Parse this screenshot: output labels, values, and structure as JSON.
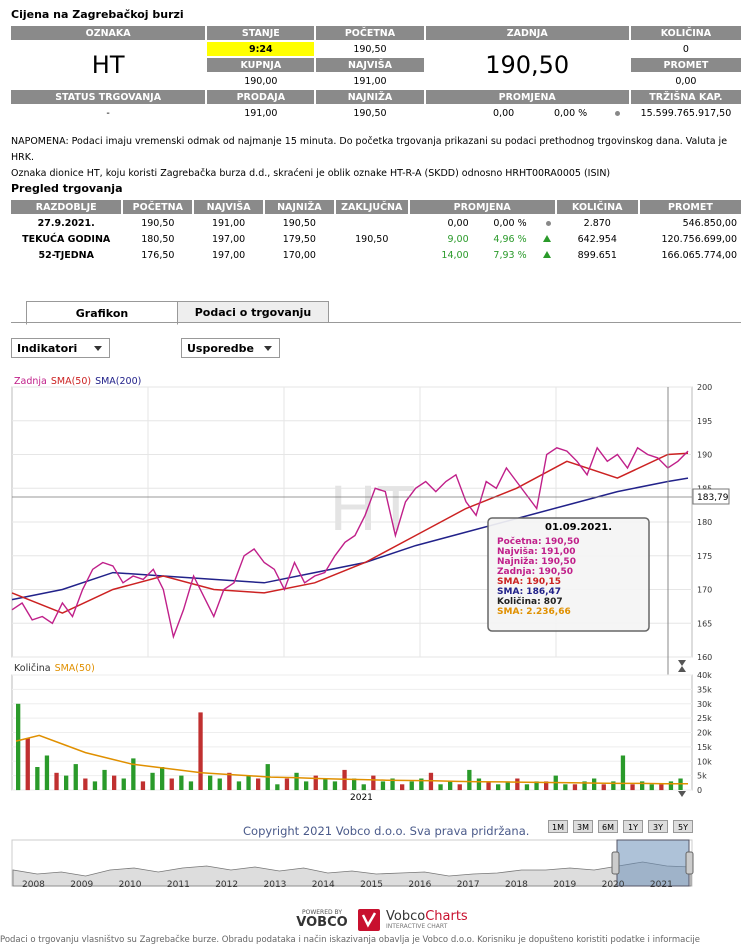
{
  "title": "Cijena na Zagrebačkoj burzi",
  "quote": {
    "oznaka_h": "OZNAKA",
    "oznaka": "HT",
    "stanje_h": "STANJE",
    "stanje": "9:24",
    "pocetna_h": "POČETNA",
    "pocetna": "190,50",
    "zadnja_h": "ZADNJA",
    "zadnja": "190,50",
    "kolicina_h": "KOLIČINA",
    "kolicina": "0",
    "kupnja_h": "KUPNJA",
    "kupnja": "190,00",
    "najvisa_h": "NAJVIŠA",
    "najvisa": "191,00",
    "promet_h": "PROMET",
    "promet": "0,00",
    "status_h": "STATUS TRGOVANJA",
    "status": "-",
    "prodaja_h": "PRODAJA",
    "prodaja": "191,00",
    "najniza_h": "NAJNIŽA",
    "najniza": "190,50",
    "promjena_h": "PROMJENA",
    "promjena": "0,00",
    "promjena_pct": "0,00 %",
    "trzisna_h": "TRŽIŠNA KAP.",
    "trzisna": "15.599.765.917,50"
  },
  "note": {
    "line1": "NAPOMENA: Podaci imaju vremenski odmak od najmanje 15 minuta. Do početka trgovanja prikazani su podaci prethodnog trgovinskog dana. Valuta je HRK.",
    "line2": "Oznaka dionice HT, koju koristi Zagrebačka burza d.d., skraćeni je oblik oznake HT-R-A (SKDD) odnosno HRHT00RA0005 (ISIN)"
  },
  "overview": {
    "title": "Pregled trgovanja",
    "headers": [
      "RAZDOBLJE",
      "POČETNA",
      "NAJVIŠA",
      "NAJNIŽA",
      "ZAKLJUČNA",
      "PROMJENA",
      "KOLIČINA",
      "PROMET"
    ],
    "zakljucna": "190,50",
    "rows": [
      {
        "period": "27.9.2021.",
        "open": "190,50",
        "high": "191,00",
        "low": "190,50",
        "chg": "0,00",
        "pct": "0,00 %",
        "qty": "2.870",
        "turnover": "546.850,00"
      },
      {
        "period": "TEKUĆA GODINA",
        "open": "180,50",
        "high": "197,00",
        "low": "179,50",
        "chg": "9,00",
        "pct": "4,96 %",
        "qty": "642.954",
        "turnover": "120.756.699,00"
      },
      {
        "period": "52-TJEDNA",
        "open": "176,50",
        "high": "197,00",
        "low": "170,00",
        "chg": "14,00",
        "pct": "7,93 %",
        "qty": "899.651",
        "turnover": "166.065.774,00"
      }
    ]
  },
  "tabs": [
    "Grafikon",
    "Podaci o trgovanju"
  ],
  "dropdowns": {
    "indikatori": "Indikatori",
    "usporedbe": "Usporedbe"
  },
  "price_legend": {
    "zadnja": "Zadnja",
    "sma50": "SMA(50)",
    "sma200": "SMA(200)"
  },
  "watermark": "HT",
  "price_axis": [
    "200",
    "195",
    "190",
    "185",
    "180",
    "175",
    "170",
    "165",
    "160"
  ],
  "crosshair_label": "183,79",
  "tooltip": {
    "date": "01.09.2021.",
    "lines": [
      {
        "text": "Početna: 190,50",
        "color": "#c0208a"
      },
      {
        "text": "Najviša: 191,00",
        "color": "#c0208a"
      },
      {
        "text": "Najniža: 190,50",
        "color": "#c0208a"
      },
      {
        "text": "Zadnja: 190,50",
        "color": "#c0208a"
      },
      {
        "text": "SMA: 190,15",
        "color": "#cc2222"
      },
      {
        "text": "SMA: 186,47",
        "color": "#22228a"
      },
      {
        "text": "Količina: 807",
        "color": "#222222"
      },
      {
        "text": "SMA: 2.236,66",
        "color": "#e09000"
      }
    ]
  },
  "volume_legend": {
    "kolicina": "Količina",
    "sma50": "SMA(50)"
  },
  "volume_axis": [
    "40k",
    "35k",
    "30k",
    "25k",
    "20k",
    "15k",
    "10k",
    "5k",
    "0"
  ],
  "volume_xlabel": "2021",
  "copyright": "Copyright 2021 Vobco d.o.o. Sva prava pridržana.",
  "ranges": [
    "1M",
    "3M",
    "6M",
    "1Y",
    "3Y",
    "5Y"
  ],
  "navigator_years": [
    "2008",
    "2009",
    "2010",
    "2011",
    "2012",
    "2013",
    "2014",
    "2015",
    "2016",
    "2017",
    "2018",
    "2019",
    "2020",
    "2021"
  ],
  "brand": {
    "powered": "POWERED BY",
    "vobco": "VOBCO",
    "charts1": "Vobco",
    "charts2": "Charts",
    "interactive": "INTERACTIVE CHART"
  },
  "footer": "Podaci o trgovanju vlasništvo su Zagrebačke burze. Obradu podataka i način iskazivanja obavlja je Vobco d.o.o. Korisniku je dopušteno koristiti podatke i informacije",
  "colors": {
    "header_gray": "#8a8a8a",
    "highlight": "#ffff00",
    "price": "#c0208a",
    "sma50": "#cc2222",
    "sma200": "#22228a",
    "vol_sma": "#e09000",
    "up": "#2a9a2a"
  },
  "chart_data": [
    {
      "type": "line",
      "title": "",
      "series": [
        {
          "name": "Zadnja",
          "x": [
            0,
            10,
            20,
            30,
            40,
            50,
            60,
            70,
            80,
            90,
            100,
            110,
            120,
            130,
            140,
            150,
            160,
            170,
            180,
            190,
            200,
            210,
            220,
            230,
            240,
            250,
            260,
            270,
            280,
            290,
            300,
            310,
            320,
            330,
            340,
            350,
            360,
            370,
            380,
            390,
            400,
            410,
            420,
            430,
            440,
            450,
            460,
            470,
            480,
            490,
            500,
            510,
            520,
            530,
            540,
            550,
            560,
            570,
            580,
            590,
            600,
            610,
            620,
            630,
            640,
            650,
            660,
            670
          ],
          "values": [
            167,
            168,
            165.5,
            166,
            165,
            168,
            166,
            170,
            173,
            174,
            173.5,
            171,
            172,
            171.5,
            173,
            170,
            163,
            167,
            172,
            169,
            166,
            170,
            171,
            175,
            176,
            174,
            173,
            170,
            174,
            171,
            172,
            172.5,
            175,
            177,
            178,
            181,
            185,
            184.5,
            178,
            183,
            185,
            186,
            184.5,
            186,
            187,
            183,
            181,
            186,
            185,
            188,
            186,
            184,
            182,
            190,
            191,
            190.5,
            189,
            187,
            191,
            189,
            190,
            188,
            191,
            190,
            189.5,
            188,
            189,
            190.5
          ]
        },
        {
          "name": "SMA(50)",
          "x": [
            0,
            50,
            100,
            150,
            200,
            250,
            300,
            350,
            400,
            450,
            500,
            550,
            600,
            650,
            670
          ],
          "values": [
            169.5,
            166.5,
            170,
            172,
            170,
            169.5,
            171,
            174,
            178,
            182,
            185,
            189,
            186.5,
            190,
            190.2
          ]
        },
        {
          "name": "SMA(200)",
          "x": [
            0,
            50,
            100,
            150,
            200,
            250,
            300,
            350,
            400,
            450,
            500,
            550,
            600,
            650,
            670
          ],
          "values": [
            168.5,
            170,
            172.5,
            172,
            171.5,
            171,
            172.5,
            174,
            176.5,
            178.5,
            180.5,
            182.5,
            184.5,
            186,
            186.5
          ]
        }
      ],
      "ylim": [
        160,
        200
      ]
    },
    {
      "type": "bar",
      "series": [
        {
          "name": "Količina",
          "values": [
            30,
            18,
            8,
            12,
            6,
            5,
            9,
            4,
            3,
            7,
            5,
            4,
            11,
            3,
            6,
            8,
            4,
            5,
            3,
            27,
            5,
            4,
            6,
            3,
            5,
            4,
            9,
            2,
            4,
            6,
            3,
            5,
            4,
            3,
            7,
            4,
            2,
            5,
            3,
            4,
            2,
            3,
            4,
            6,
            2,
            3,
            2,
            7,
            4,
            3,
            2,
            3,
            4,
            2,
            3,
            3,
            5,
            2,
            2,
            3,
            4,
            2,
            3,
            12,
            2,
            3,
            2,
            2,
            3,
            4
          ]
        },
        {
          "name": "SMA(50)",
          "values": [
            17,
            19,
            16,
            13,
            11,
            9,
            8,
            7,
            6,
            5.5,
            5,
            4.5,
            4.3,
            4,
            3.8,
            3.6,
            3.4,
            3.3,
            3.2,
            3,
            2.9,
            2.8,
            2.7,
            2.6,
            2.5,
            2.4,
            2.3,
            2.3,
            2.2,
            2.2
          ]
        }
      ],
      "ylim": [
        0,
        40
      ]
    }
  ]
}
